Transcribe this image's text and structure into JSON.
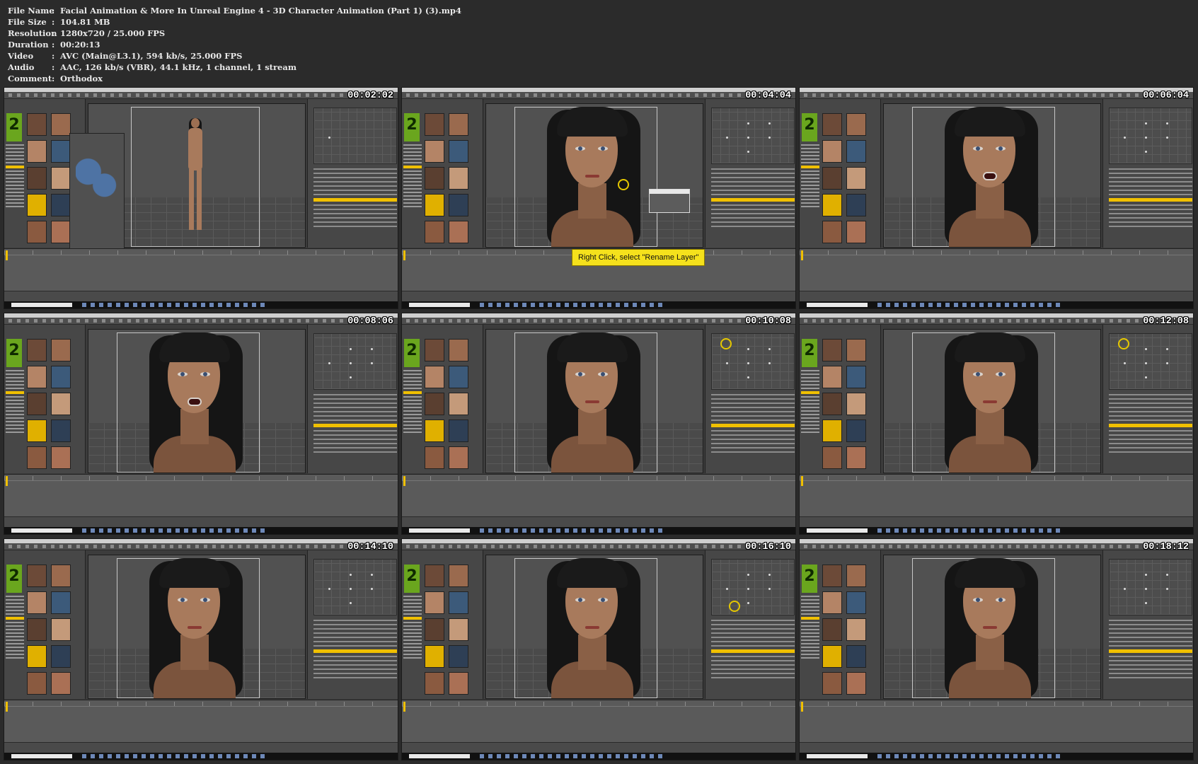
{
  "header": {
    "rows": [
      {
        "key": "File Name",
        "value": "Facial Animation & More In Unreal Engine 4 - 3D Character Animation (Part 1) (3).mp4"
      },
      {
        "key": "File Size",
        "value": "104.81 MB"
      },
      {
        "key": "Resolution",
        "value": "1280x720 / 25.000 FPS"
      },
      {
        "key": "Duration",
        "value": "00:20:13"
      },
      {
        "key": "Video",
        "value": "AVC (Main@L3.1), 594 kb/s, 25.000 FPS"
      },
      {
        "key": "Audio",
        "value": "AAC, 126 kb/s (VBR), 44.1 kHz, 1 channel, 1 stream"
      },
      {
        "key": "Comment",
        "value": "Orthodox"
      }
    ],
    "separator": ":"
  },
  "thumbnails": [
    {
      "timestamp": "00:02:02",
      "scene": "full-body"
    },
    {
      "timestamp": "00:04:04",
      "scene": "face",
      "caption": "Right Click, select \"Rename Layer\""
    },
    {
      "timestamp": "00:06:04",
      "scene": "face-open"
    },
    {
      "timestamp": "00:08:06",
      "scene": "face-open"
    },
    {
      "timestamp": "00:10:08",
      "scene": "face"
    },
    {
      "timestamp": "00:12:08",
      "scene": "face"
    },
    {
      "timestamp": "00:14:10",
      "scene": "face"
    },
    {
      "timestamp": "00:16:10",
      "scene": "face"
    },
    {
      "timestamp": "00:18:12",
      "scene": "face-smile"
    }
  ],
  "colors": {
    "background": "#2b2b2b",
    "caption_bg": "#f5e11c",
    "accent": "#f0c000",
    "genesis_logo": "#6aa61e"
  },
  "icons": [
    "genesis-2-logo-icon",
    "search-icon",
    "windows-start-icon"
  ]
}
